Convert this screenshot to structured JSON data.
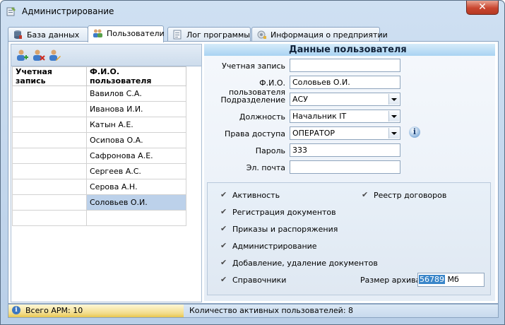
{
  "window": {
    "title": "Администрирование",
    "close_label": "✕"
  },
  "tabs": [
    {
      "label": "База данных",
      "icon": "database-icon"
    },
    {
      "label": "Пользователи",
      "icon": "users-icon"
    },
    {
      "label": "Лог программы",
      "icon": "log-icon"
    },
    {
      "label": "Информация о предприятии",
      "icon": "company-info-icon"
    }
  ],
  "toolbar": {
    "buttons": [
      "add-user-icon",
      "delete-user-icon",
      "edit-user-icon"
    ]
  },
  "users_table": {
    "headers": [
      "Учетная запись",
      "Ф.И.О. пользователя"
    ],
    "rows": [
      {
        "account": "",
        "name": "Вавилов С.А."
      },
      {
        "account": "",
        "name": "Иванова И.И."
      },
      {
        "account": "",
        "name": "Катын А.Е."
      },
      {
        "account": "",
        "name": "Осипова О.А."
      },
      {
        "account": "",
        "name": "Сафронова А.Е."
      },
      {
        "account": "",
        "name": "Сергеев А.С."
      },
      {
        "account": "",
        "name": "Серова А.Н."
      },
      {
        "account": "",
        "name": "Соловьев О.И."
      },
      {
        "account": "",
        "name": ""
      }
    ],
    "selected_index": 7
  },
  "user_form": {
    "title": "Данные пользователя",
    "fields": {
      "account": {
        "label": "Учетная запись",
        "value": ""
      },
      "fullname": {
        "label": "Ф.И.О. пользователя",
        "value": "Соловьев О.И."
      },
      "department": {
        "label": "Подразделение",
        "value": "АСУ"
      },
      "position": {
        "label": "Должность",
        "value": "Начальник IT"
      },
      "access": {
        "label": "Права доступа",
        "value": "ОПЕРАТОР"
      },
      "password": {
        "label": "Пароль",
        "value": "333"
      },
      "email": {
        "label": "Эл. почта",
        "value": ""
      }
    },
    "permissions": [
      {
        "label": "Активность",
        "checked": true
      },
      {
        "label": "Реестр договоров",
        "checked": true
      },
      {
        "label": "Регистрация документов",
        "checked": true
      },
      {
        "label": "Приказы и распоряжения",
        "checked": true
      },
      {
        "label": "Администрирование",
        "checked": true
      },
      {
        "label": "Добавление, удаление документов",
        "checked": true
      },
      {
        "label": "Справочники",
        "checked": true
      }
    ],
    "archive": {
      "label": "Размер архива",
      "value": "56789",
      "unit": "Мб"
    }
  },
  "status": {
    "total_workstations": "Всего АРМ: 10",
    "active_users": "Количество активных пользователей: 8"
  },
  "colors": {
    "selection": "#bcd1ea",
    "header_gradient": "#a9d3f2",
    "status_highlight": "#f2dc8a"
  }
}
